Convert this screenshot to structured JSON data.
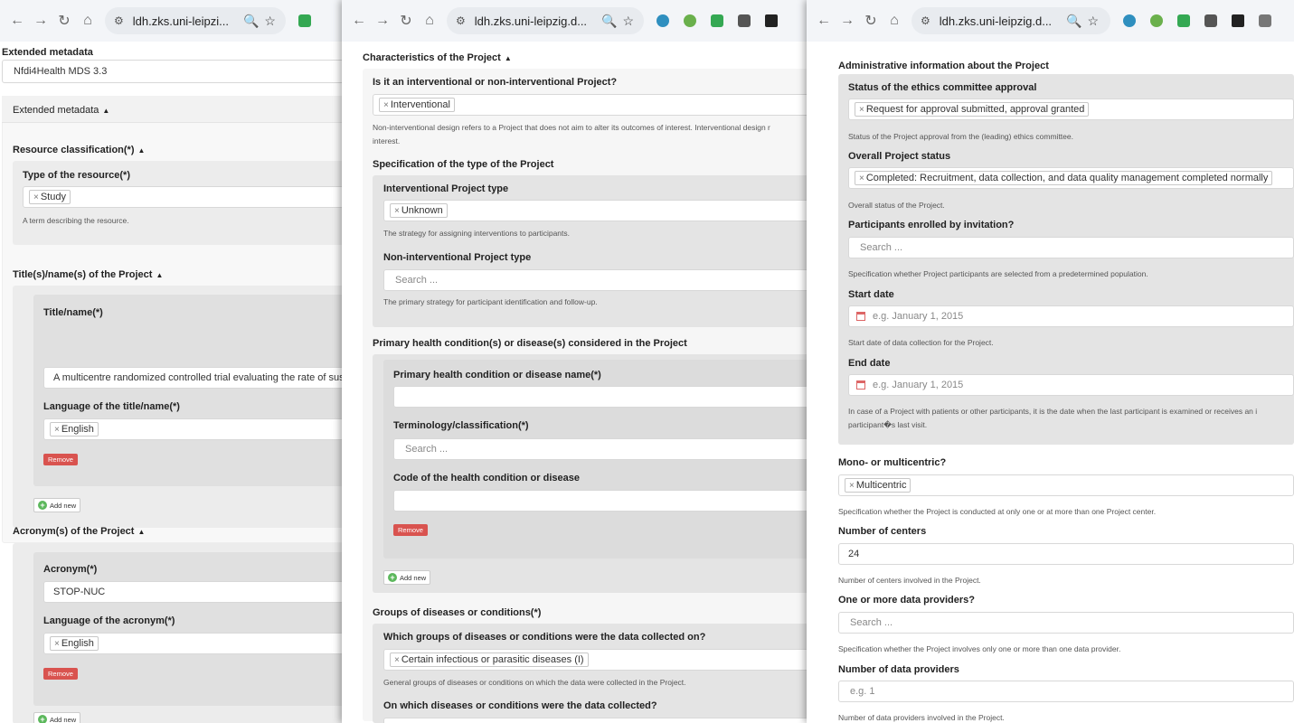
{
  "windows": [
    {
      "url": "ldh.zks.uni-leipzi...",
      "tune_icon": "tune-icon",
      "zoom_icon": "zoom-icon",
      "star_icon": "star-icon"
    },
    {
      "url": "ldh.zks.uni-leipzig.d...",
      "tune_icon": "tune-icon",
      "zoom_icon": "zoom-icon",
      "star_icon": "star-icon"
    },
    {
      "url": "ldh.zks.uni-leipzig.d...",
      "tune_icon": "tune-icon",
      "zoom_icon": "zoom-icon",
      "star_icon": "star-icon"
    }
  ],
  "w1": {
    "ext_meta_label": "Extended metadata",
    "ext_meta_value": "Nfdi4Health MDS 3.3",
    "ext_meta_section": "Extended metadata",
    "res_class": "Resource classification(*)",
    "type_label": "Type of the resource(*)",
    "type_tag": "Study",
    "type_help": "A term describing the resource.",
    "titles_section": "Title(s)/name(s) of the Project",
    "title_label": "Title/name(*)",
    "title_value": "A multicentre randomized controlled trial evaluating the rate of sus",
    "title_lang_label": "Language of the title/name(*)",
    "title_lang_tag": "English",
    "remove": "Remove",
    "add_new": "Add new",
    "acronyms_section": "Acronym(s) of the Project",
    "acronym_label": "Acronym(*)",
    "acronym_value": "STOP-NUC",
    "acronym_lang_label": "Language of the acronym(*)",
    "acronym_lang_tag": "English"
  },
  "w2": {
    "char_section": "Characteristics of the Project",
    "interv_q": "Is it an interventional or non-interventional Project?",
    "interv_tag": "Interventional",
    "interv_help": "Non-interventional design refers to a Project that does not aim to alter its outcomes of interest. Interventional design r",
    "interv_help2": "interest.",
    "spec_type": "Specification of the type of the Project",
    "ipt_label": "Interventional Project type",
    "ipt_tag": "Unknown",
    "ipt_help": "The strategy for assigning interventions to participants.",
    "nipt_label": "Non-interventional Project type",
    "nipt_placeholder": "Search ...",
    "nipt_help": "The primary strategy for participant identification and follow-up.",
    "phc_section": "Primary health condition(s) or disease(s) considered in the Project",
    "phc_name_label": "Primary health condition or disease name(*)",
    "term_label": "Terminology/classification(*)",
    "term_placeholder": "Search ...",
    "code_label": "Code of the health condition or disease",
    "remove": "Remove",
    "add_new": "Add new",
    "groups_section": "Groups of diseases or conditions(*)",
    "groups_q": "Which groups of diseases or conditions were the data collected on?",
    "groups_tag": "Certain infectious or parasitic diseases (I)",
    "groups_help": "General groups of diseases or conditions on which the data were collected in the Project.",
    "which_q": "On which diseases or conditions were the data collected?"
  },
  "w3": {
    "admin_section": "Administrative information about the Project",
    "ethics_label": "Status of the ethics committee approval",
    "ethics_tag": "Request for approval submitted, approval granted",
    "ethics_help": "Status of the Project approval from the (leading) ethics committee.",
    "overall_label": "Overall Project status",
    "overall_tag": "Completed: Recruitment, data collection, and data quality management completed normally",
    "overall_help": "Overall status of the Project.",
    "invite_label": "Participants enrolled by invitation?",
    "invite_placeholder": "Search ...",
    "invite_help": "Specification whether Project participants are selected from a predetermined population.",
    "start_label": "Start date",
    "start_placeholder": "e.g. January 1, 2015",
    "start_help": "Start date of data collection for the Project.",
    "end_label": "End date",
    "end_placeholder": "e.g. January 1, 2015",
    "end_help": "In case of a Project with patients or other participants, it is the date when the last participant is examined or receives an i",
    "end_help2": "participant�s last visit.",
    "mono_label": "Mono- or multicentric?",
    "mono_tag": "Multicentric",
    "mono_help": "Specification whether the Project is conducted at only one or at more than one Project center.",
    "centers_label": "Number of centers",
    "centers_value": "24",
    "centers_help": "Number of centers involved in the Project.",
    "providers_label": "One or more data providers?",
    "providers_placeholder": "Search ...",
    "providers_help": "Specification whether the Project involves only one or more than one data provider.",
    "num_prov_label": "Number of data providers",
    "num_prov_placeholder": "e.g. 1",
    "num_prov_help": "Number of data providers involved in the Project."
  }
}
